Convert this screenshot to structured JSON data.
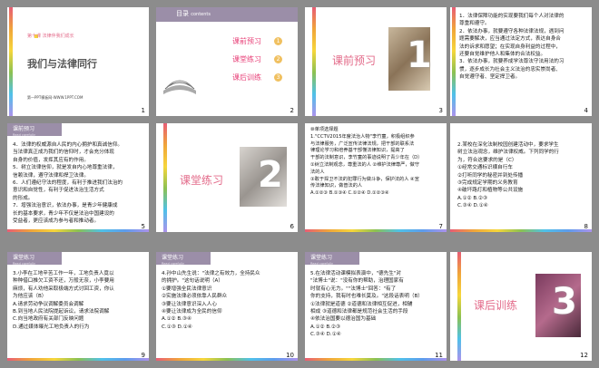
{
  "slides": {
    "s1": {
      "lesson": "第十课 法律伴我们成长",
      "title": "我们与法律同行",
      "footer": "第一PPT模板网-WWW.1PPT.COM",
      "num": "1"
    },
    "s2": {
      "header": "目录",
      "header_en": "contents",
      "items": [
        "课前预习",
        "课堂练习",
        "课后训练"
      ],
      "item_nums": [
        "1",
        "2",
        "3"
      ],
      "num": "2"
    },
    "s3": {
      "title": "课前预习",
      "big": "1",
      "num": "3"
    },
    "s4": {
      "lines": [
        "1．法律保障功能的实现要我们每个人对法律的",
        "尊重和遵守。",
        "2．依法办事，就要遵守各种法律法规，遇到问",
        "题需要解决，应当通过法定方式，表达自身合",
        "法的诉求和愿望；在实现自身利益的过程中，",
        "还要自觉维护他人和集体的合法权益。",
        "3．依法办事，就要养成学法尊法守法用法的习",
        "惯，逐步成长为社会主义法治的忠实崇尚者、",
        "自觉遵守者、坚定捍卫者。"
      ],
      "num": "4"
    },
    "s5": {
      "bar": "课前预习",
      "bar_en": "Read carefully",
      "lines": [
        "4．法律的权威源自人民的内心拥护和真诚信仰。",
        "当法律真正成为我们的信仰时，才会充分体现",
        "自身的价值，发挥其应有的作用。",
        "5．树立法律信仰，就是发自内心地尊重法律，",
        "信赖法律，遵守法律和捍卫法律。",
        "6．人们遵纪守法的程度，有利于推进我们法治的",
        "意识和自觉性，有利于促进法治生活方式",
        "的形成。",
        "7．增强法治意识，依法办事，是青少年健康成",
        "长的基本要求，青少年不仅是法治中国建设的",
        "受益者，更应该成为参与者和推动者。"
      ],
      "num": "5"
    },
    "s6": {
      "title": "课堂练习",
      "big": "2",
      "num": "6"
    },
    "s7": {
      "lines": [
        "⑩单项选择题",
        "1.\"CCTV2015年度法治人物\"李竹童，积极组织参",
        "与法律服务，广泛宣传法律法规，把干部的联系法",
        "律理论学习和培养基干部懂法律知识，提高了",
        "干部的法制意识，李竹童的事迹说明了青少年在（D）",
        "①树立法制观念，尊重法的人 ②维护法律尊严，做守",
        "法的人",
        "③敢于捍卫不法的犯罪行为做斗争，保护法的人 ④宣",
        "传法律知识，做普法的人",
        "A.①②③ B.①③④ C.①②④ D.①②③④"
      ],
      "num": "7"
    },
    "s8": {
      "lines": [
        "2.某校在深化法制校园创建活动中，要求学生",
        "树立法治观念，维护法律权威。下列同学的行",
        "为，符合这要求的是（C）",
        "①经常交通标识横自行车",
        "②打听同学的秘密并到处传播",
        "③完成规定学期的义务教育",
        "④破坏路灯和植物等公共设施",
        "A.①② B.②③",
        "C.③④ D.①④"
      ],
      "num": "8"
    },
    "s9": {
      "bar": "课堂练习",
      "bar_en": "Read carefully",
      "lines": [
        "3.小李在工地辛苦工作一年，工地负责人竟以",
        "种种借口推欠工资不还，万般无奈，小李要用",
        "麻烦，有人劝他采取极端方式讨回工资，你认",
        "为他应该（B）",
        "A.请求劳动争议调解委员会调解",
        "B.到当地人民法院提起诉讼，请求法院调解",
        "C.向当地政府有关部门反映问题",
        "D.通过媒体曝光工地负责人的行为"
      ],
      "num": "9"
    },
    "s10": {
      "bar": "课堂练习",
      "bar_en": "Read carefully",
      "lines": [
        "4.孙中山先生说：\"法律之有效力，全持民众",
        "的拥护。\"这句话说明（A）",
        "①要增强全民法律意识",
        "②实施法律必须依靠人民群众",
        "③要让法律意识深入人心",
        "④要让法律成为全民的信仰",
        "A.①②   B.③④",
        "C.①③   D.①④"
      ],
      "num": "10"
    },
    "s11": {
      "bar": "课堂练习",
      "bar_en": "Read carefully",
      "lines": [
        "5.在法律活动课模拟表演中，\"德先生\"对",
        "\"法博士\"说：\"没有你的帮助，治理国家有",
        "时就有心无力。\"\"法博士\"回答：\"有了",
        "你的支持，我有时也难长莫及。\"这段话表明（B）",
        "①法律就是道德 ②道德和法律相互促进，相辅",
        "相成 ③道德和法律都是规范社会生活的手段",
        "④依法治国要以德治国为基础",
        "A.①② B.②③",
        "C.③④ D.①④"
      ],
      "num": "11"
    },
    "s12": {
      "title": "课后训练",
      "big": "3",
      "num": "12"
    }
  }
}
